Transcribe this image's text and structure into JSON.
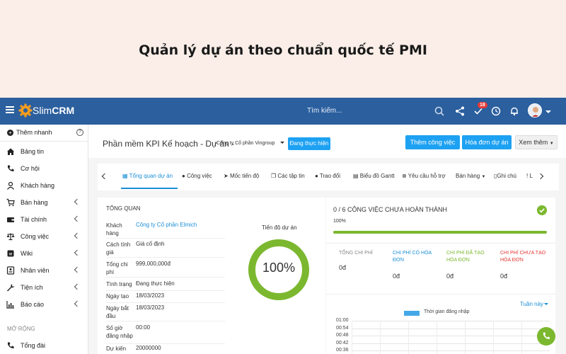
{
  "banner": {
    "title": "Quản lý dự án theo chuẩn quốc tế PMI"
  },
  "topbar": {
    "logo_prefix": "Slim",
    "logo_bold": "CRM",
    "search_placeholder": "Tìm kiếm...",
    "notification_count": "18"
  },
  "sidebar": {
    "quick_add": "Thêm nhanh",
    "items": [
      {
        "label": "Bảng tin",
        "icon": "home-icon",
        "has_children": false
      },
      {
        "label": "Cơ hội",
        "icon": "phone-icon",
        "has_children": false
      },
      {
        "label": "Khách hàng",
        "icon": "user-icon",
        "has_children": false
      },
      {
        "label": "Bán hàng",
        "icon": "cart-icon",
        "has_children": true
      },
      {
        "label": "Tài chính",
        "icon": "wallet-icon",
        "has_children": true
      },
      {
        "label": "Công việc",
        "icon": "scale-icon",
        "has_children": true
      },
      {
        "label": "Wiki",
        "icon": "book-icon",
        "has_children": true
      },
      {
        "label": "Nhân viên",
        "icon": "id-card-icon",
        "has_children": true
      },
      {
        "label": "Tiện ích",
        "icon": "wrench-icon",
        "has_children": true
      },
      {
        "label": "Báo cáo",
        "icon": "bar-chart-icon",
        "has_children": true
      }
    ],
    "section_label": "MỞ RỘNG",
    "extra_item": "Tổng đài"
  },
  "header": {
    "project_title": "Phần mềm KPI Kế hoạch - Dự án -",
    "company": "Công ty Cổ phần Vingroup",
    "status": "Đang thực hiện",
    "add_task_label": "Thêm công việc",
    "invoice_label": "Hóa đơn dự án",
    "more_label": "Xem thêm"
  },
  "tabs": [
    {
      "label": "Tổng quan dự án"
    },
    {
      "label": "Công việc"
    },
    {
      "label": "Mốc tiến độ"
    },
    {
      "label": "Các tập tin"
    },
    {
      "label": "Trao đổi"
    },
    {
      "label": "Biểu đồ Gantt"
    },
    {
      "label": "Yêu cầu hỗ trợ"
    },
    {
      "label": "Bán hàng"
    },
    {
      "label": "Ghi chú"
    },
    {
      "label": "L"
    }
  ],
  "overview": {
    "title": "TỔNG QUAN",
    "rows": [
      {
        "key": "Khách hàng",
        "value": "Công ty Cổ phần Elmich"
      },
      {
        "key": "Cách tính giá",
        "value": "Giá cố định"
      },
      {
        "key": "Tổng chi phí",
        "value": "999,000,000đ"
      },
      {
        "key": "Tình trạng",
        "value": "Đang thực hiện"
      },
      {
        "key": "Ngày tạo",
        "value": "18/03/2023"
      },
      {
        "key": "Ngày bắt đầu",
        "value": "18/03/2023"
      },
      {
        "key": "Số giờ đăng nhập",
        "value": "00:00"
      },
      {
        "key": "Dự kiến",
        "value": "20000000"
      }
    ],
    "gauge_label": "Tiến độ dự án",
    "gauge_value": "100%",
    "gauge_fraction": 1.0
  },
  "tasks": {
    "title": "0 / 6 CÔNG VIỆC CHƯA HOÀN THÀNH",
    "percent": "100%",
    "progress_fraction": 1.0,
    "costs": [
      {
        "label": "TỔNG CHI PHÍ",
        "value": "0đ",
        "color": "#888888"
      },
      {
        "label": "CHI PHÍ CÓ HÓA ĐƠN",
        "value": "0đ",
        "color": "#1a8fd6"
      },
      {
        "label": "CHI PHÍ ĐÃ TẠO HÓA ĐƠN",
        "value": "0đ",
        "color": "#7cb82f"
      },
      {
        "label": "CHI PHÍ CHƯA TẠO HÓA ĐƠN",
        "value": "0đ",
        "color": "#e53935"
      }
    ],
    "period": "Tuần này"
  },
  "chart_data": {
    "type": "bar",
    "series": [
      {
        "name": "Thời gian đăng nhập",
        "values": []
      }
    ],
    "y_ticks": [
      "01:00",
      "00:54",
      "00:48",
      "00:42",
      "00:36"
    ]
  },
  "colors": {
    "topbar": "#2b5f9e",
    "accent": "#1da1f2",
    "success": "#7cb82f"
  }
}
